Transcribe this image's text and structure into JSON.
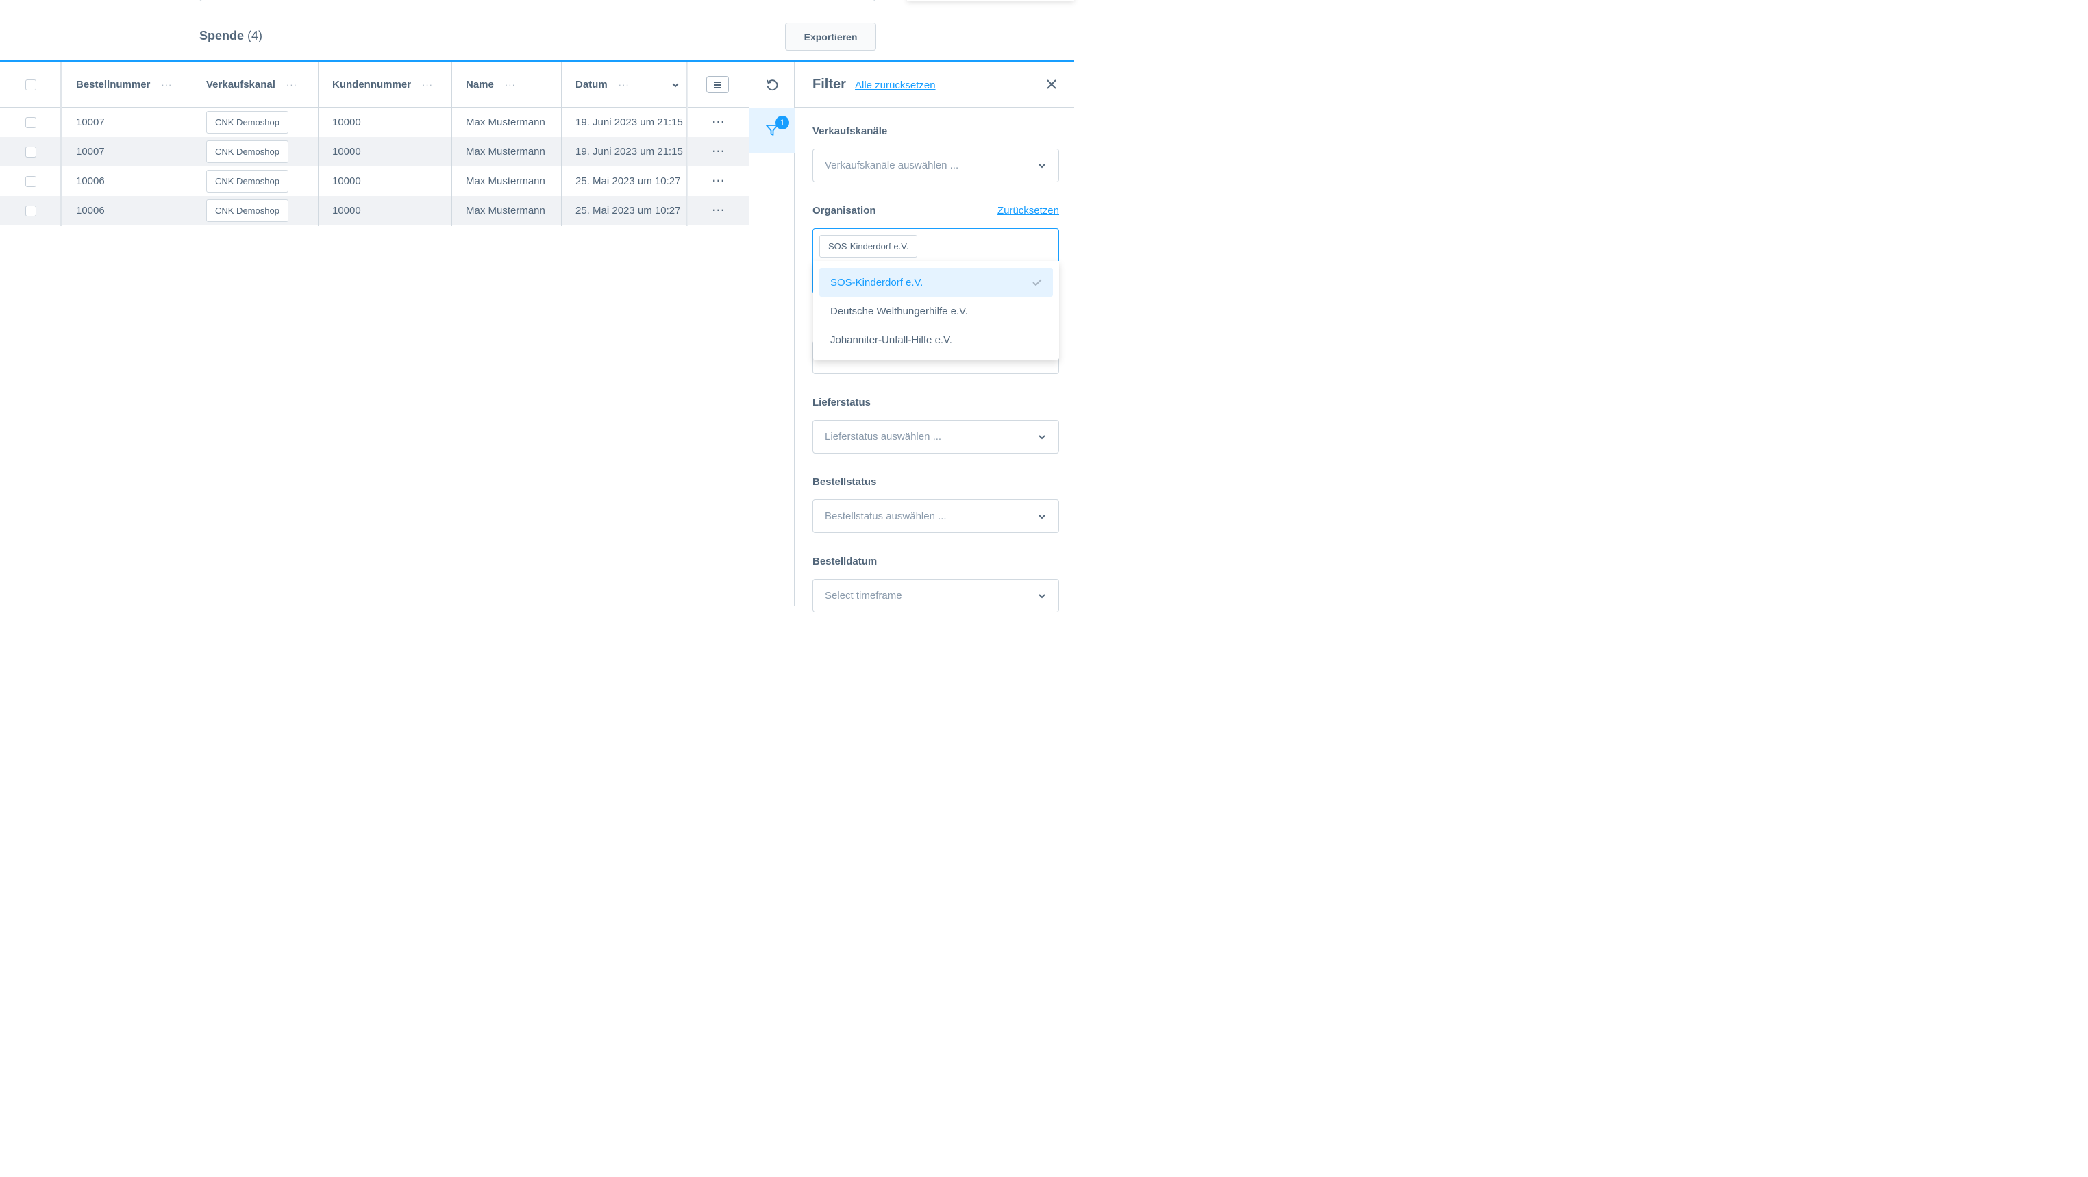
{
  "header": {
    "title": "Spende",
    "count": "(4)",
    "export_label": "Exportieren"
  },
  "table": {
    "columns": [
      {
        "label": "Bestellnummer"
      },
      {
        "label": "Verkaufskanal"
      },
      {
        "label": "Kundennummer"
      },
      {
        "label": "Name"
      },
      {
        "label": "Datum"
      }
    ],
    "rows": [
      {
        "order": "10007",
        "channel": "CNK Demoshop",
        "customer": "10000",
        "name": "Max Mustermann",
        "date": "19. Juni 2023 um 21:15"
      },
      {
        "order": "10007",
        "channel": "CNK Demoshop",
        "customer": "10000",
        "name": "Max Mustermann",
        "date": "19. Juni 2023 um 21:15"
      },
      {
        "order": "10006",
        "channel": "CNK Demoshop",
        "customer": "10000",
        "name": "Max Mustermann",
        "date": "25. Mai 2023 um 10:27"
      },
      {
        "order": "10006",
        "channel": "CNK Demoshop",
        "customer": "10000",
        "name": "Max Mustermann",
        "date": "25. Mai 2023 um 10:27"
      }
    ],
    "row_action_icon": "more-horizontal-icon"
  },
  "sidebar": {
    "refresh_icon": "refresh-icon",
    "filter_icon": "filter-icon",
    "filter_badge": "1"
  },
  "filter": {
    "title": "Filter",
    "reset_all": "Alle zurücksetzen",
    "sections": {
      "channels": {
        "label": "Verkaufskanäle",
        "placeholder": "Verkaufskanäle auswählen ..."
      },
      "organisation": {
        "label": "Organisation",
        "reset": "Zurücksetzen",
        "selected_chip": "SOS-Kinderdorf e.V."
      },
      "delivery": {
        "label": "Lieferstatus",
        "placeholder": "Lieferstatus auswählen ..."
      },
      "order_status": {
        "label": "Bestellstatus",
        "placeholder": "Bestellstatus auswählen ..."
      },
      "order_date": {
        "label": "Bestelldatum",
        "placeholder": "Select timeframe"
      }
    },
    "dropdown_options": [
      {
        "label": "SOS-Kinderdorf e.V.",
        "selected": true
      },
      {
        "label": "Deutsche Welthungerhilfe e.V.",
        "selected": false
      },
      {
        "label": "Johanniter-Unfall-Hilfe e.V.",
        "selected": false
      }
    ]
  },
  "colors": {
    "accent": "#189eff",
    "text": "#52667a",
    "border": "#d1d9e0",
    "row_alt": "#f0f2f5",
    "selected_bg": "#e5f3ff"
  }
}
